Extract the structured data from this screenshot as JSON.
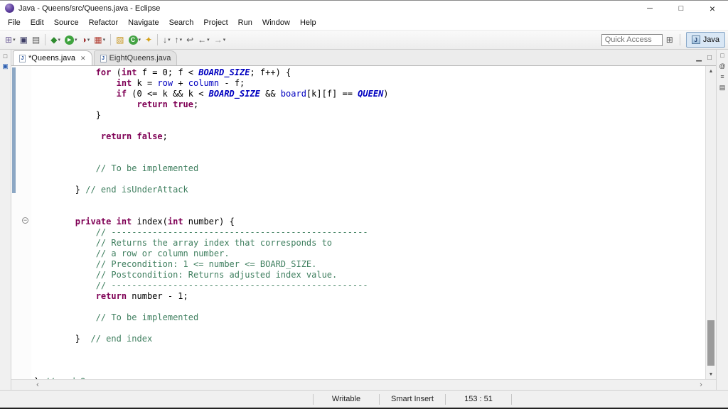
{
  "window": {
    "title": "Java - Queens/src/Queens.java - Eclipse",
    "controls": {
      "minimize": "─",
      "maximize": "□",
      "close": "×"
    }
  },
  "menu": {
    "items": [
      "File",
      "Edit",
      "Source",
      "Refactor",
      "Navigate",
      "Search",
      "Project",
      "Run",
      "Window",
      "Help"
    ]
  },
  "toolbar": {
    "quick_access_placeholder": "Quick Access",
    "perspective_label": "Java",
    "perspective_icon_letter": "J",
    "open_perspective_glyph": "⊞",
    "icons": [
      {
        "name": "new-wizard-icon",
        "glyph": "⊞",
        "color": "#6b5b95",
        "dd": true
      },
      {
        "name": "save-icon",
        "glyph": "▣",
        "color": "#3d3d66"
      },
      {
        "name": "print-icon",
        "glyph": "▤",
        "color": "#555555"
      },
      {
        "sep": true
      },
      {
        "name": "debug-icon",
        "glyph": "◆",
        "color": "#2e8b2e",
        "dd": true
      },
      {
        "name": "run-icon",
        "glyph": "▶",
        "css": "circle-green",
        "dd": true
      },
      {
        "name": "coverage-icon",
        "glyph": "◑",
        "color": "#a03030",
        "dd": true
      },
      {
        "name": "external-tools-icon",
        "glyph": "▦",
        "color": "#b03a2e",
        "dd": true
      },
      {
        "sep": true
      },
      {
        "name": "new-java-project-icon",
        "glyph": "▧",
        "color": "#c8961e"
      },
      {
        "name": "new-class-icon",
        "glyph": "C",
        "css": "circle-class",
        "dd": true
      },
      {
        "name": "search-icon",
        "glyph": "✦",
        "color": "#d4a017"
      },
      {
        "sep": true
      },
      {
        "name": "next-annotation-icon",
        "glyph": "↓",
        "color": "#555555",
        "dd": true
      },
      {
        "name": "prev-annotation-icon",
        "glyph": "↑",
        "color": "#555555",
        "dd": true
      },
      {
        "name": "last-edit-location-icon",
        "glyph": "↩",
        "color": "#555555"
      },
      {
        "name": "back-icon",
        "glyph": "←",
        "color": "#555555",
        "dd": true
      },
      {
        "name": "forward-icon",
        "glyph": "→",
        "color": "#999999",
        "dd": true
      }
    ]
  },
  "left_strip": {
    "icons": [
      {
        "name": "restore-pane-icon",
        "glyph": "□",
        "color": "#555555"
      },
      {
        "name": "package-explorer-icon",
        "glyph": "▣",
        "color": "#2a5db0"
      }
    ]
  },
  "right_strip": {
    "icons": [
      {
        "name": "restore-pane-icon",
        "glyph": "□",
        "color": "#555555"
      },
      {
        "name": "javadoc-view-icon",
        "glyph": "@",
        "color": "#444444"
      },
      {
        "name": "declaration-view-icon",
        "glyph": "≡",
        "color": "#444444"
      },
      {
        "name": "console-view-icon",
        "glyph": "▤",
        "color": "#444444"
      }
    ]
  },
  "tabs": [
    {
      "label": "*Queens.java",
      "active": true
    },
    {
      "label": "EightQueens.java",
      "active": false
    }
  ],
  "tabs_meta": {
    "file_icon_letter": "J",
    "minimize_view_glyph": "▁",
    "maximize_view_glyph": "□"
  },
  "scrollbar": {
    "up": "▲",
    "down": "▼",
    "left": "‹",
    "right": "›"
  },
  "editor": {
    "lines": [
      [
        [
          "p",
          "            "
        ],
        [
          "k",
          "for"
        ],
        [
          "p",
          " ("
        ],
        [
          "k",
          "int"
        ],
        [
          "p",
          " f = 0; f < "
        ],
        [
          "s",
          "BOARD_SIZE"
        ],
        [
          "p",
          "; f++) {"
        ]
      ],
      [
        [
          "p",
          "                "
        ],
        [
          "k",
          "int"
        ],
        [
          "p",
          " k = "
        ],
        [
          "f",
          "row"
        ],
        [
          "p",
          " + "
        ],
        [
          "f",
          "column"
        ],
        [
          "p",
          " - f;"
        ]
      ],
      [
        [
          "p",
          "                "
        ],
        [
          "k",
          "if"
        ],
        [
          "p",
          " (0 <= k && k < "
        ],
        [
          "s",
          "BOARD_SIZE"
        ],
        [
          "p",
          " && "
        ],
        [
          "f",
          "board"
        ],
        [
          "p",
          "[k][f] == "
        ],
        [
          "s",
          "QUEEN"
        ],
        [
          "p",
          ")"
        ]
      ],
      [
        [
          "p",
          "                    "
        ],
        [
          "k",
          "return"
        ],
        [
          "p",
          " "
        ],
        [
          "k",
          "true"
        ],
        [
          "p",
          ";"
        ]
      ],
      [
        [
          "p",
          "            }"
        ]
      ],
      [],
      [
        [
          "p",
          "             "
        ],
        [
          "k",
          "return"
        ],
        [
          "p",
          " "
        ],
        [
          "k",
          "false"
        ],
        [
          "p",
          ";"
        ]
      ],
      [],
      [],
      [
        [
          "p",
          "            "
        ],
        [
          "c",
          "// To be implemented"
        ]
      ],
      [],
      [
        [
          "p",
          "        } "
        ],
        [
          "c",
          "// end isUnderAttack"
        ]
      ],
      [],
      [],
      [
        [
          "p",
          "        "
        ],
        [
          "k",
          "private"
        ],
        [
          "p",
          " "
        ],
        [
          "k",
          "int"
        ],
        [
          "p",
          " index("
        ],
        [
          "k",
          "int"
        ],
        [
          "p",
          " number) {"
        ]
      ],
      [
        [
          "p",
          "            "
        ],
        [
          "c",
          "// --------------------------------------------------"
        ]
      ],
      [
        [
          "p",
          "            "
        ],
        [
          "c",
          "// Returns the array index that corresponds to"
        ]
      ],
      [
        [
          "p",
          "            "
        ],
        [
          "c",
          "// a row or column number."
        ]
      ],
      [
        [
          "p",
          "            "
        ],
        [
          "c",
          "// Precondition: 1 <= number <= BOARD_SIZE."
        ]
      ],
      [
        [
          "p",
          "            "
        ],
        [
          "c",
          "// Postcondition: Returns adjusted index value."
        ]
      ],
      [
        [
          "p",
          "            "
        ],
        [
          "c",
          "// --------------------------------------------------"
        ]
      ],
      [
        [
          "p",
          "            "
        ],
        [
          "k",
          "return"
        ],
        [
          "p",
          " number - 1;"
        ]
      ],
      [],
      [
        [
          "p",
          "            "
        ],
        [
          "c",
          "// To be implemented"
        ]
      ],
      [],
      [
        [
          "p",
          "        }  "
        ],
        [
          "c",
          "// end index"
        ]
      ],
      [],
      [],
      [],
      [
        [
          "p",
          "} "
        ],
        [
          "c",
          "// end Queens"
        ]
      ]
    ]
  },
  "status_bar": {
    "writable": "Writable",
    "insert_mode": "Smart Insert",
    "caret_position": "153 : 51"
  },
  "colors": {
    "keyword": "#7F0055",
    "comment": "#3F7F5F",
    "static": "#0000C0",
    "field": "#0000C0",
    "plain": "#000000",
    "range": "#8CA7C4"
  }
}
